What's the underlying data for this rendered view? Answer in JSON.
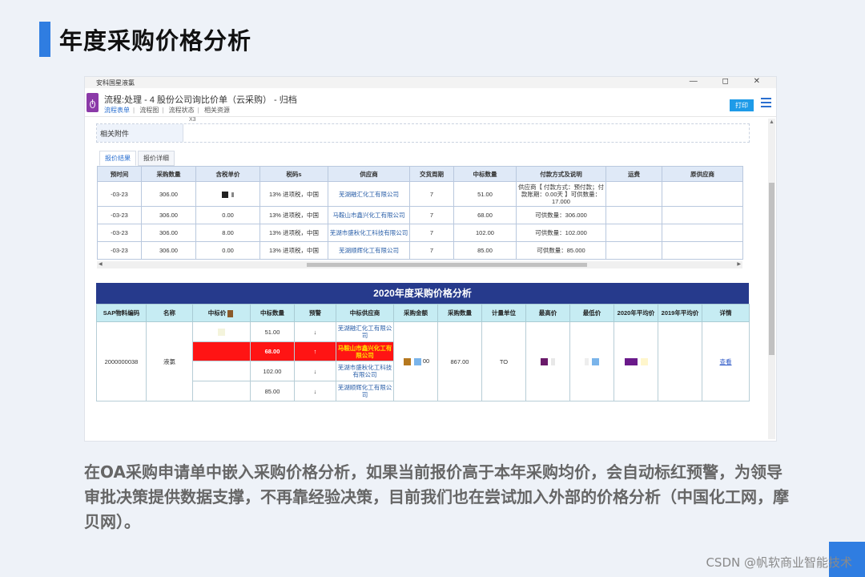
{
  "page": {
    "title": "年度采购价格分析",
    "caption": "在OA采购申请单中嵌入采购价格分析，如果当前报价高于本年采购均价，会自动标红预警，为领导审批决策提供数据支撑，不再靠经验决策，目前我们也在尝试加入外部的价格分析（中国化工网，摩贝网）。",
    "watermark": "CSDN @帆软商业智能技术"
  },
  "window": {
    "title": "安科国星液氯",
    "controls": "— ◻ ✕"
  },
  "flow": {
    "logo": "ტ",
    "title": "流程:处理 - 4 股份公司询比价单（云采购） - 归档",
    "tabs": [
      "流程表单",
      "流程图",
      "流程状态",
      "相关资源"
    ],
    "print_label": "打印"
  },
  "attach": {
    "label": "相关附件",
    "top_text": "X3"
  },
  "sub_tabs": [
    "报价结果",
    "报价详细"
  ],
  "quote_table": {
    "headers": [
      "预时间",
      "采购数量",
      "含税单价",
      "税码s",
      "供应商",
      "交货周期",
      "中标数量",
      "付款方式及说明",
      "运费",
      "原供应商"
    ],
    "rows": [
      [
        "-03-23",
        "306.00",
        "",
        "13% 进项税，中国",
        "芜湖融汇化工有限公司",
        "7",
        "51.00",
        "供应商【 付款方式：预付款；付款账期：0.00天 】可供数量：17.000",
        "",
        ""
      ],
      [
        "-03-23",
        "306.00",
        "0.00",
        "13% 进项税，中国",
        "马鞍山市鑫兴化工有限公司",
        "7",
        "68.00",
        "可供数量：306.000",
        "",
        ""
      ],
      [
        "-03-23",
        "306.00",
        "8.00",
        "13% 进项税，中国",
        "芜湖市盛秋化工科技有限公司",
        "7",
        "102.00",
        "可供数量：102.000",
        "",
        ""
      ],
      [
        "-03-23",
        "306.00",
        "0.00",
        "13% 进项税，中国",
        "芜湖顺辉化工有限公司",
        "7",
        "85.00",
        "可供数量：85.000",
        "",
        ""
      ]
    ]
  },
  "analysis": {
    "title": "2020年度采购价格分析",
    "headers": [
      "SAP物料编码",
      "名称",
      "中标价",
      "中标数量",
      "预警",
      "中标供应商",
      "采购金额",
      "采购数量",
      "计量单位",
      "最高价",
      "最低价",
      "2020年平均价",
      "2019年平均价",
      "详情"
    ],
    "material_code": "2000000038",
    "name": "液氯",
    "rows": [
      {
        "qty": "51.00",
        "warn": "↓",
        "supplier": "芜湖融汇化工有限公司"
      },
      {
        "qty": "68.00",
        "warn": "↑",
        "supplier": "马鞍山市鑫兴化工有限公司"
      },
      {
        "qty": "102.00",
        "warn": "↓",
        "supplier": "芜湖市盛秋化工科技有限公司"
      },
      {
        "qty": "85.00",
        "warn": "↓",
        "supplier": "芜湖顺辉化工有限公司"
      }
    ],
    "amount_suffix": "00",
    "purchase_qty": "867.00",
    "unit": "TO",
    "detail_link": "查看"
  },
  "colors": {
    "accent": "#2f7de1",
    "banner": "#263a8c",
    "warn": "#ff1414"
  }
}
